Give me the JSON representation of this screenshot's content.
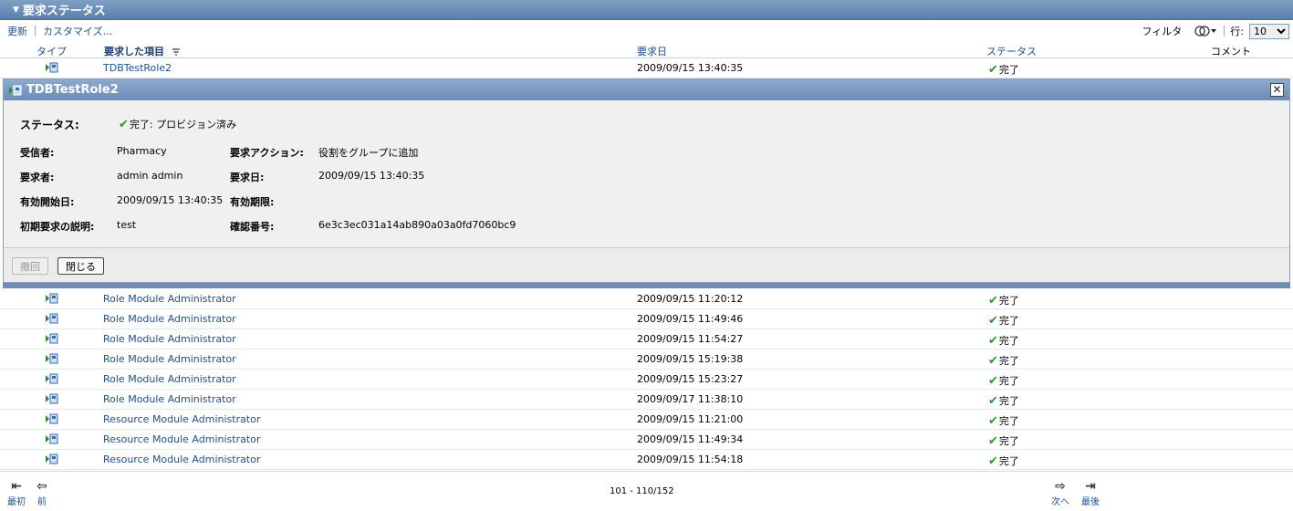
{
  "title": "要求ステータス",
  "toolbar": {
    "refresh": "更新",
    "customize": "カスタマイズ...",
    "filter": "フィルタ",
    "rows_label": "行:",
    "rows_value": "10"
  },
  "columns": {
    "type": "タイプ",
    "item": "要求した項目",
    "date": "要求日",
    "status": "ステータス",
    "comment": "コメント"
  },
  "first_row": {
    "item": "TDBTestRole2",
    "date": "2009/09/15 13:40:35",
    "status": "完了"
  },
  "detail": {
    "title": "TDBTestRole2",
    "status_label": "ステータス:",
    "status_value": "完了: プロビジョン済み",
    "recipient_label": "受信者:",
    "recipient_value": "Pharmacy",
    "action_label": "要求アクション:",
    "action_value": "役割をグループに追加",
    "requester_label": "要求者:",
    "requester_value": "admin admin",
    "reqdate_label": "要求日:",
    "reqdate_value": "2009/09/15 13:40:35",
    "start_label": "有効開始日:",
    "start_value": "2009/09/15 13:40:35",
    "expiry_label": "有効期限:",
    "desc_label": "初期要求の説明:",
    "desc_value": "test",
    "confirm_label": "確認番号:",
    "confirm_value": "6e3c3ec031a14ab890a03a0fd7060bc9",
    "withdraw_button": "撤回",
    "close_button": "閉じる"
  },
  "rows": [
    {
      "item": "Role Module Administrator",
      "date": "2009/09/15 11:20:12",
      "status": "完了"
    },
    {
      "item": "Role Module Administrator",
      "date": "2009/09/15 11:49:46",
      "status": "完了"
    },
    {
      "item": "Role Module Administrator",
      "date": "2009/09/15 11:54:27",
      "status": "完了"
    },
    {
      "item": "Role Module Administrator",
      "date": "2009/09/15 15:19:38",
      "status": "完了"
    },
    {
      "item": "Role Module Administrator",
      "date": "2009/09/15 15:23:27",
      "status": "完了"
    },
    {
      "item": "Role Module Administrator",
      "date": "2009/09/17 11:38:10",
      "status": "完了"
    },
    {
      "item": "Resource Module Administrator",
      "date": "2009/09/15 11:21:00",
      "status": "完了"
    },
    {
      "item": "Resource Module Administrator",
      "date": "2009/09/15 11:49:34",
      "status": "完了"
    },
    {
      "item": "Resource Module Administrator",
      "date": "2009/09/15 11:54:18",
      "status": "完了"
    }
  ],
  "pager": {
    "first": "最初",
    "prev": "前",
    "info": "101 - 110/152",
    "next": "次へ",
    "last": "最後"
  }
}
